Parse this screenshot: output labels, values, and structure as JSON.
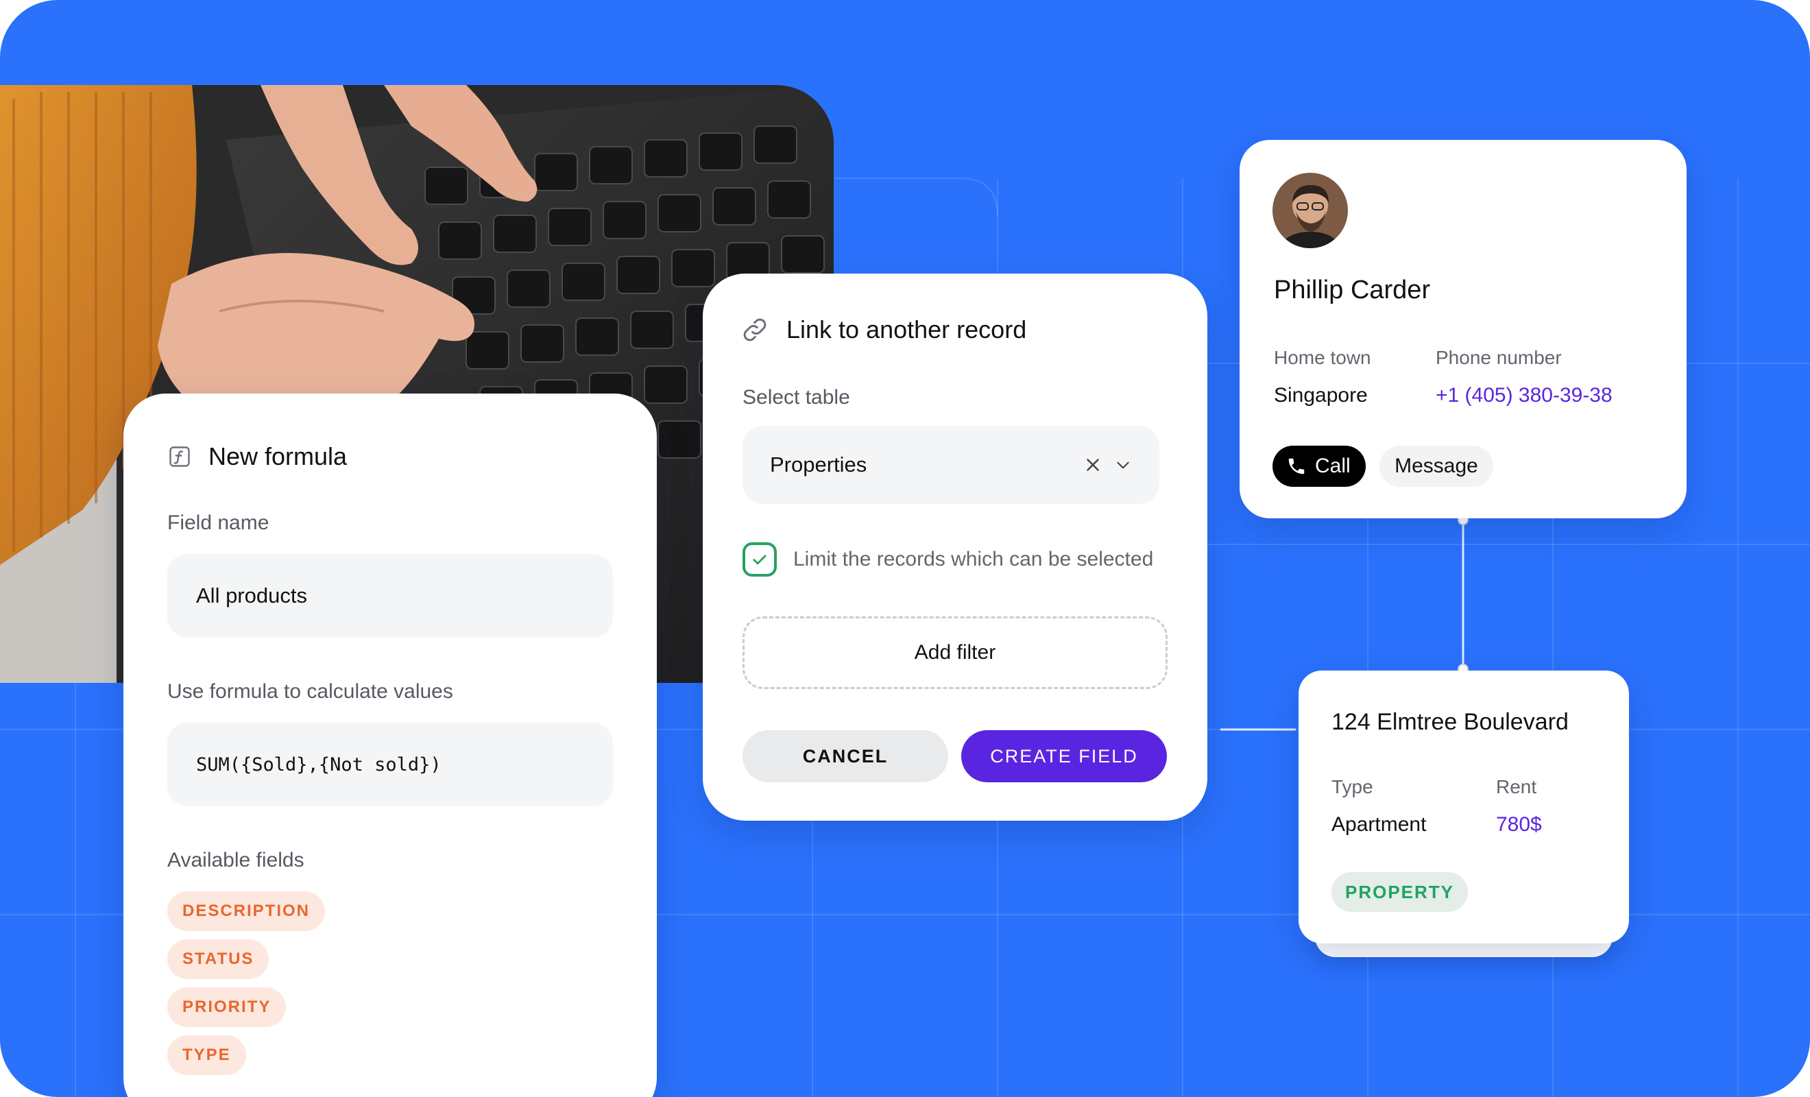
{
  "colors": {
    "background": "#2a71fc",
    "accent_purple": "#5a25e0",
    "chip_orange": "#e8672f",
    "chip_orange_bg": "#fde8df",
    "success_green": "#29a064",
    "tag_green_bg": "#e4ede8"
  },
  "photo": {
    "subject": "hands typing on a dark keyboard, orange knit sweater"
  },
  "formula_card": {
    "icon": "function-icon",
    "title": "New formula",
    "field_name_label": "Field name",
    "field_name_value": "All products",
    "formula_label": "Use formula to calculate values",
    "formula_value": "SUM({Sold},{Not sold})",
    "available_label": "Available fields",
    "fields": [
      "DESCRIPTION",
      "STATUS",
      "PRIORITY",
      "TYPE"
    ]
  },
  "link_card": {
    "icon": "link-icon",
    "title": "Link to another record",
    "select_label": "Select table",
    "select_value": "Properties",
    "limit_checked": true,
    "limit_label": "Limit the records which can be selected",
    "add_filter": "Add filter",
    "cancel": "CANCEL",
    "create": "CREATE FIELD"
  },
  "contact_card": {
    "name": "Phillip Carder",
    "home_town_label": "Home town",
    "home_town": "Singapore",
    "phone_label": "Phone number",
    "phone": "+1 (405) 380-39-38",
    "call": "Call",
    "message": "Message"
  },
  "property_card": {
    "title": "124 Elmtree Boulevard",
    "type_label": "Type",
    "type_value": "Apartment",
    "rent_label": "Rent",
    "rent_value": "780$",
    "tag": "PROPERTY"
  }
}
